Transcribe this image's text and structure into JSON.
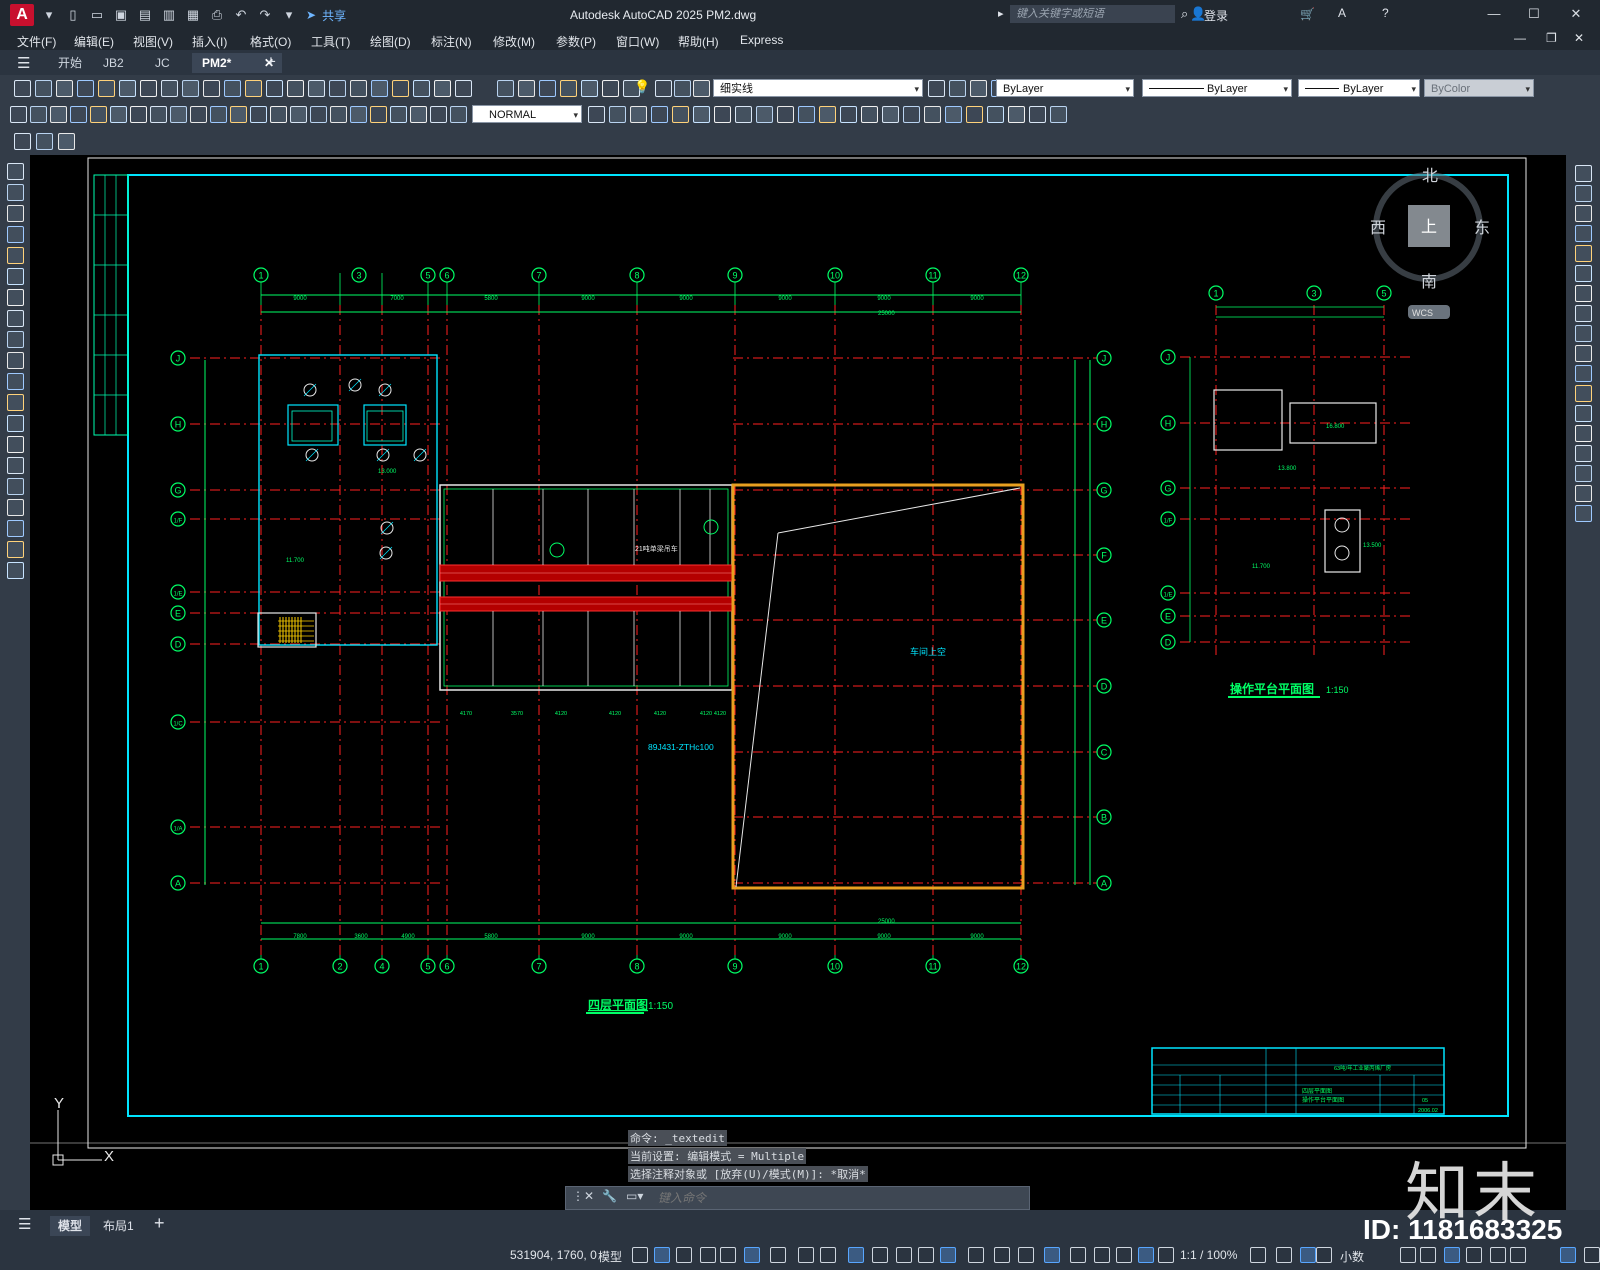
{
  "app": {
    "logo": "A",
    "title": "Autodesk AutoCAD 2025    PM2.dwg",
    "share_label": "共享",
    "search_placeholder": "键入关键字或短语",
    "login_label": "登录"
  },
  "menu": [
    "文件(F)",
    "编辑(E)",
    "视图(V)",
    "插入(I)",
    "格式(O)",
    "工具(T)",
    "绘图(D)",
    "标注(N)",
    "修改(M)",
    "参数(P)",
    "窗口(W)",
    "帮助(H)",
    "Express"
  ],
  "tabs": [
    {
      "label": "开始"
    },
    {
      "label": "JB2"
    },
    {
      "label": "JC"
    },
    {
      "label": "PM2*",
      "active": true
    }
  ],
  "properties": {
    "layer": "细实线",
    "color": "ByLayer",
    "linetype": "ByLayer",
    "lineweight": "ByLayer",
    "plotstyle": "ByColor",
    "dimstyle": "NORMAL"
  },
  "viewcube": {
    "north": "北",
    "south": "南",
    "east": "东",
    "west": "西",
    "top": "上",
    "wcs": "WCS"
  },
  "ucs": {
    "x": "X",
    "y": "Y"
  },
  "drawing": {
    "plan_title": "四层平面图",
    "plan_scale": "1:150",
    "platform_title": "操作平台平面图",
    "platform_scale": "1:150",
    "void_label": "车间上空",
    "crane_note": "21吨单梁吊车",
    "detail_ref": "89J431-ZTHc100",
    "col_axes_top": [
      "1",
      "3",
      "5",
      "6",
      "7",
      "8",
      "9",
      "10",
      "11",
      "12"
    ],
    "col_axes_bottom": [
      "1",
      "2",
      "4",
      "5",
      "6",
      "7",
      "8",
      "9",
      "10",
      "11",
      "12"
    ],
    "row_axes_left": [
      "J",
      "H",
      "G",
      "1/F",
      "1/E",
      "E",
      "D",
      "1/C",
      "1/A",
      "A"
    ],
    "row_axes_right": [
      "J",
      "H",
      "G",
      "F",
      "E",
      "D",
      "C",
      "B",
      "A"
    ],
    "platform_col_axes": [
      "1",
      "3",
      "5"
    ],
    "platform_row_axes": [
      "J",
      "H",
      "G",
      "1/F",
      "1/E",
      "E",
      "D"
    ],
    "top_dims": [
      "9000",
      "7000",
      "5800",
      "9000",
      "9000",
      "9000",
      "9000",
      "9000"
    ],
    "top_dim_total": "25000",
    "bottom_dims": [
      "7800",
      "3600",
      "4900",
      "5800",
      "9000",
      "9000",
      "9000",
      "9000",
      "9000"
    ],
    "bottom_dim_total": "25000",
    "bay_dims": [
      "4170",
      "3570",
      "4120",
      "4120",
      "4120",
      "4120",
      "4120"
    ],
    "elevations": [
      "11.700",
      "13.000",
      "16.800",
      "13.500",
      "13.800",
      "11.700"
    ],
    "title_block": {
      "project": "63吨/年工业聚丙烯厂房",
      "drawing_name_1": "四层平面图",
      "drawing_name_2": "操作平台平面图",
      "sheet": "05",
      "date": "2006.02"
    }
  },
  "command": {
    "history": [
      "命令: _textedit",
      "当前设置: 编辑模式 = Multiple",
      "选择注释对象或 [放弃(U)/模式(M)]: *取消*"
    ],
    "placeholder": "键入命令"
  },
  "layouts": [
    {
      "label": "模型",
      "active": true
    },
    {
      "label": "布局1"
    }
  ],
  "status": {
    "coords": "531904, 1760, 0",
    "model": "模型",
    "scale": "1:1 / 100%",
    "units": "小数"
  },
  "watermark": {
    "brand": "知末",
    "id": "ID: 1181683325"
  }
}
